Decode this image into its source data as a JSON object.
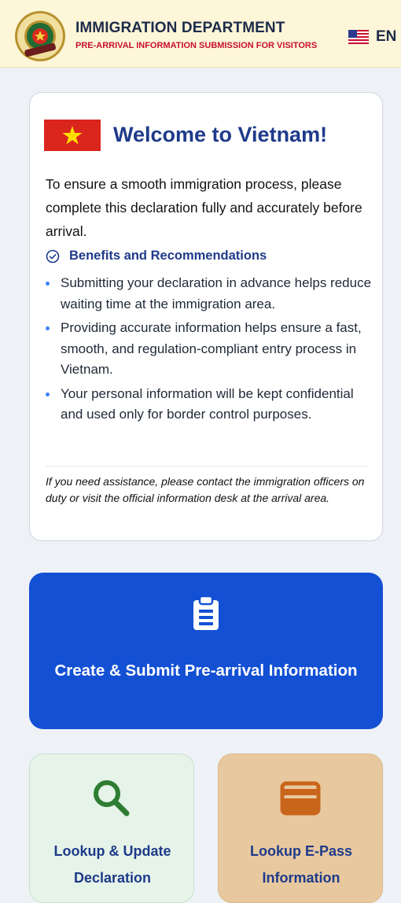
{
  "header": {
    "title": "IMMIGRATION DEPARTMENT",
    "subtitle": "PRE-ARRIVAL INFORMATION SUBMISSION FOR VISITORS",
    "emblem_text": "QUẢN LÝ XUẤT NHẬP CẢNH · IMMIGRATION",
    "language": "EN",
    "language_icon": "us-flag-icon"
  },
  "welcome": {
    "flag_icon": "vietnam-flag-icon",
    "title": "Welcome to Vietnam!",
    "intro": "To ensure a smooth immigration process, please complete this declaration fully and accurately before arrival.",
    "benefits_title": "Benefits and Recommendations",
    "benefits": [
      "Submitting your declaration in advance helps reduce waiting time at the immigration area.",
      "Providing accurate information helps ensure a fast, smooth, and regulation-compliant entry process in Vietnam.",
      "Your personal information will be kept confidential and used only for border control purposes."
    ],
    "assistance": "If you need assistance, please contact the immigration officers on duty or visit the official information desk at the arrival area."
  },
  "actions": {
    "create": {
      "label": "Create & Submit Pre-arrival Information",
      "icon": "clipboard-icon"
    },
    "lookup": {
      "label": "Lookup & Update Declaration",
      "icon": "search-icon"
    },
    "epass": {
      "label": "Lookup E-Pass Information",
      "icon": "card-icon"
    }
  },
  "colors": {
    "header_bg": "#fdf6d8",
    "accent_red": "#c8102e",
    "title_blue": "#1e3a8a",
    "primary_button": "#1350d4",
    "lookup_bg": "#e6f3e8",
    "epass_bg": "#e8c99f",
    "search_icon_green": "#2e7d32",
    "card_icon_orange": "#c9651b"
  }
}
